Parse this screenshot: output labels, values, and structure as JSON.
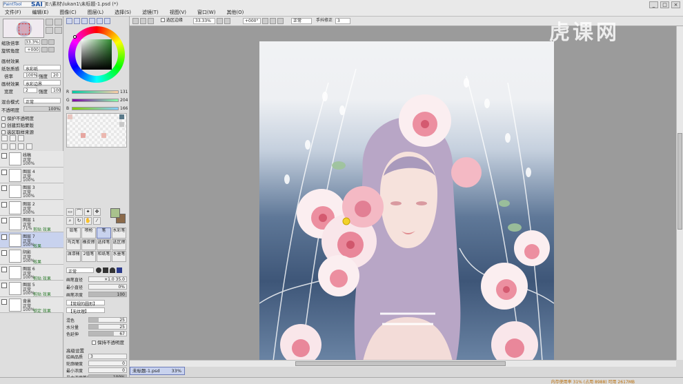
{
  "app": {
    "logo": "PaintTool",
    "logo_brand": "SAI",
    "title": "E:\\素材\\lukan1\\未标题-1.psd (*)",
    "window_buttons": [
      "_",
      "□",
      "×"
    ]
  },
  "menu": [
    "文件(F)",
    "编辑(E)",
    "图像(C)",
    "图层(L)",
    "选择(S)",
    "滤镜(T)",
    "视图(V)",
    "窗口(W)",
    "其他(O)"
  ],
  "navigator": {
    "zoom_label": "缩放倍率",
    "zoom_value": "33.3%",
    "rotate_label": "旋转角度",
    "rotate_value": "+000"
  },
  "texture": {
    "section": "画材效果",
    "paper_label": "纸张质感",
    "paper_value": "水彩纸",
    "scale_label": "倍率",
    "scale_value": "100%",
    "strength_label": "强度",
    "strength_value": "20",
    "effect_label": "画材效果",
    "effect_value": "水彩边界",
    "width_label": "宽度",
    "width_value": "2",
    "intensity_label": "强度",
    "intensity_value": "100"
  },
  "blend": {
    "mode_label": "混合模式",
    "mode_value": "正常",
    "opacity_label": "不透明度",
    "opacity_value": "100%"
  },
  "checks": [
    "保护不透明度",
    "创建剪贴蒙版",
    "选区取样来源"
  ],
  "layers": [
    {
      "name": "线稿",
      "mode": "正常",
      "pct": "100%",
      "extra": ""
    },
    {
      "name": "图层 4",
      "mode": "正常",
      "pct": "100%",
      "extra": ""
    },
    {
      "name": "图层 3",
      "mode": "正常",
      "pct": "100%",
      "extra": ""
    },
    {
      "name": "图层 2",
      "mode": "正常",
      "pct": "100%",
      "extra": ""
    },
    {
      "name": "图层 1",
      "mode": "正常",
      "pct": "71%",
      "extra": "剪贴 效果"
    },
    {
      "name": "图层 7",
      "mode": "正常",
      "pct": "100%",
      "extra": "效果"
    },
    {
      "name": "阴影",
      "mode": "正常",
      "pct": "100%",
      "extra": "效果"
    },
    {
      "name": "图层 6",
      "mode": "正常",
      "pct": "100%",
      "extra": "剪贴 效果"
    },
    {
      "name": "图层 5",
      "mode": "正常",
      "pct": "100%",
      "extra": "剪贴 效果"
    },
    {
      "name": "背景",
      "mode": "正常",
      "pct": "100%",
      "extra": "锁定 效果"
    }
  ],
  "color": {
    "r_label": "R",
    "r_value": "131",
    "g_label": "G",
    "g_value": "204",
    "b_label": "B",
    "b_value": "166",
    "primary": "#a9c28d",
    "secondary": "#8b6a4a"
  },
  "brushes": [
    "铅笔",
    "喷枪",
    "笔",
    "水彩笔",
    "马克笔",
    "橡皮擦",
    "选择笔",
    "选区擦",
    "油漆桶",
    "2值笔",
    "和纸笔",
    "水墨笔"
  ],
  "brush_props": {
    "mode": "正常",
    "size_label": "画笔直径",
    "size_mult": "×1.0",
    "size_value": "35.0",
    "min_size_label": "最小直径",
    "min_size_value": "0%",
    "density_label": "画笔浓度",
    "density_value": "100",
    "shape_label": "【常规的圆形】",
    "texture_label": "【无纹理】",
    "blend_label": "混色",
    "blend_value": "25",
    "water_label": "水分量",
    "water_value": "25",
    "persist_label": "色延伸",
    "persist_value": "67",
    "keep_opacity_label": "保持不透明度",
    "adv_label": "高级设置",
    "quality_label": "绘画品质",
    "quality_value": "3",
    "edge_label": "轮廓硬度",
    "edge_value": "0",
    "min_density_label": "最小浓度",
    "min_density_value": "0",
    "max_pressure_label": "最大浓度笔压",
    "max_pressure_value": "100%"
  },
  "canvas_toolbar": {
    "selection_edge": "选区边缘",
    "zoom": "33.33%",
    "rotation": "+000°",
    "mode": "正常",
    "stabilizer_label": "手抖修正",
    "stabilizer_value": "3"
  },
  "tab": {
    "name": "未标题-1.psd",
    "pct": "33%"
  },
  "status": {
    "text": "内存使用率 31% (占用 8988) 可用 2617MB"
  },
  "watermark": [
    "虎",
    "课",
    "网"
  ]
}
